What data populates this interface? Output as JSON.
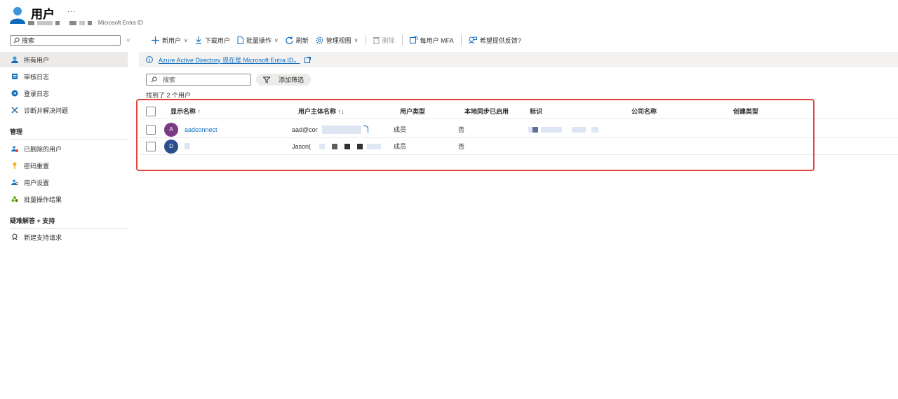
{
  "header": {
    "title": "用户",
    "more": "...",
    "subtitle_suffix": "· Microsoft Entra ID"
  },
  "sidebar": {
    "search_placeholder": "搜索",
    "collapse": "«",
    "items": [
      {
        "label": "所有用户",
        "icon": "user-icon",
        "selected": true
      },
      {
        "label": "审核日志",
        "icon": "audit-log-icon"
      },
      {
        "label": "登录日志",
        "icon": "sign-in-log-icon"
      },
      {
        "label": "诊断并解决问题",
        "icon": "wrench-icon"
      }
    ],
    "manage_header": "管理",
    "manage_items": [
      {
        "label": "已删除的用户",
        "icon": "deleted-users-icon"
      },
      {
        "label": "密码重置",
        "icon": "key-icon"
      },
      {
        "label": "用户设置",
        "icon": "user-settings-icon"
      },
      {
        "label": "批量操作结果",
        "icon": "bulk-results-icon"
      }
    ],
    "support_header": "疑难解答 + 支持",
    "support_items": [
      {
        "label": "新建支持请求",
        "icon": "support-request-icon"
      }
    ]
  },
  "toolbar": {
    "new_user": "新用户",
    "download_users": "下载用户",
    "bulk_ops": "批量操作",
    "refresh": "刷新",
    "manage_view": "管理视图",
    "delete": "删除",
    "per_user_mfa": "每用户 MFA",
    "feedback": "希望提供反馈?"
  },
  "info_bar": {
    "message": "Azure Active Directory 现在是 Microsoft Entra ID。"
  },
  "filter": {
    "search_placeholder": "搜索",
    "add_filter": "添加筛选",
    "found_text": "找到了 2 个用户"
  },
  "table": {
    "columns": {
      "display_name": "显示名称 ↑",
      "upn": "用户主体名称 ↑↓",
      "user_type": "用户类型",
      "on_prem_sync": "本地同步已启用",
      "identity": "标识",
      "company": "公司名称",
      "creation_type": "创建类型"
    },
    "rows": [
      {
        "avatar": "A",
        "avatar_color": "#7a3a84",
        "name": "aadconnect",
        "upn": "aad@cor",
        "user_type": "成员",
        "on_prem_sync": "否"
      },
      {
        "avatar": "D",
        "avatar_color": "#2b4f8c",
        "name": "",
        "upn": "Jason(",
        "user_type": "成员",
        "on_prem_sync": "否"
      }
    ]
  },
  "colors": {
    "accent": "#0f6cbd",
    "highlight": "#e0463a"
  }
}
